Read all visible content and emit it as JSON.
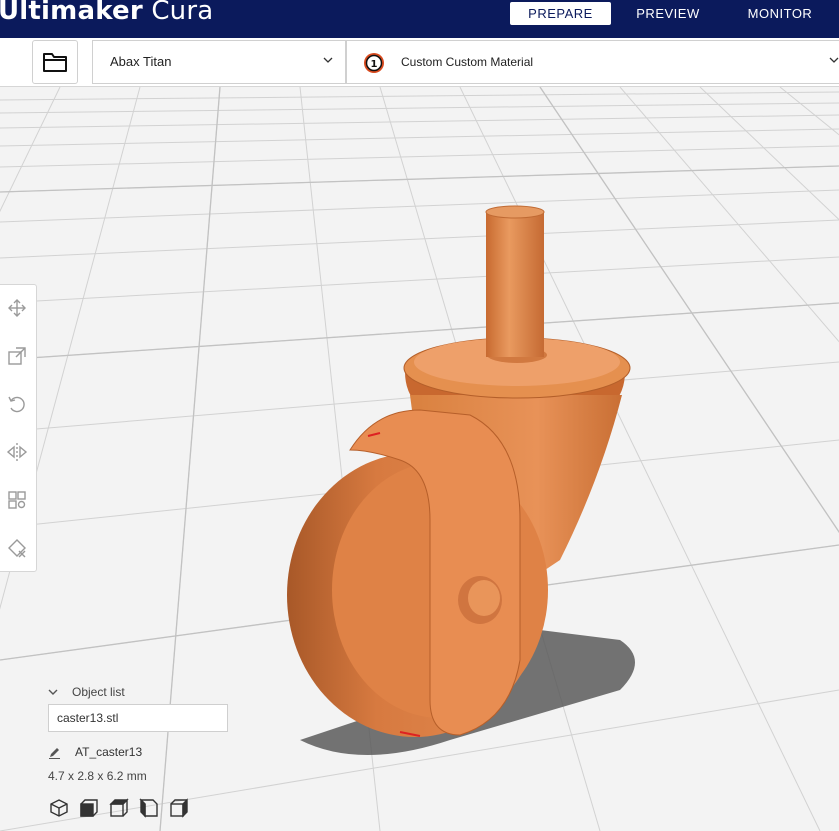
{
  "app": {
    "title_bold": "Ultimaker",
    "title_light": " Cura"
  },
  "nav": {
    "tabs": [
      {
        "label": "PREPARE",
        "active": true
      },
      {
        "label": "PREVIEW",
        "active": false
      },
      {
        "label": "MONITOR",
        "active": false
      }
    ]
  },
  "stage": {
    "printer": "Abax Titan",
    "extruder_number": "1",
    "material": "Custom Custom Material"
  },
  "toolbar": {
    "tools": [
      "move-icon",
      "scale-icon",
      "rotate-icon",
      "mirror-icon",
      "per-model-settings-icon",
      "support-blocker-icon"
    ]
  },
  "object_list": {
    "header": "Object list",
    "items": [
      "caster13.stl"
    ],
    "current_name": "AT_caster13",
    "dimensions": "4.7 x 2.8 x 6.2 mm"
  },
  "view_buttons": [
    "3d-view-icon",
    "front-view-icon",
    "top-view-icon",
    "left-view-icon",
    "right-view-icon"
  ],
  "colors": {
    "header": "#0b1a5c",
    "model": "#e0854a",
    "model_shade": "#b86230",
    "grid": "#d4d4d4"
  }
}
